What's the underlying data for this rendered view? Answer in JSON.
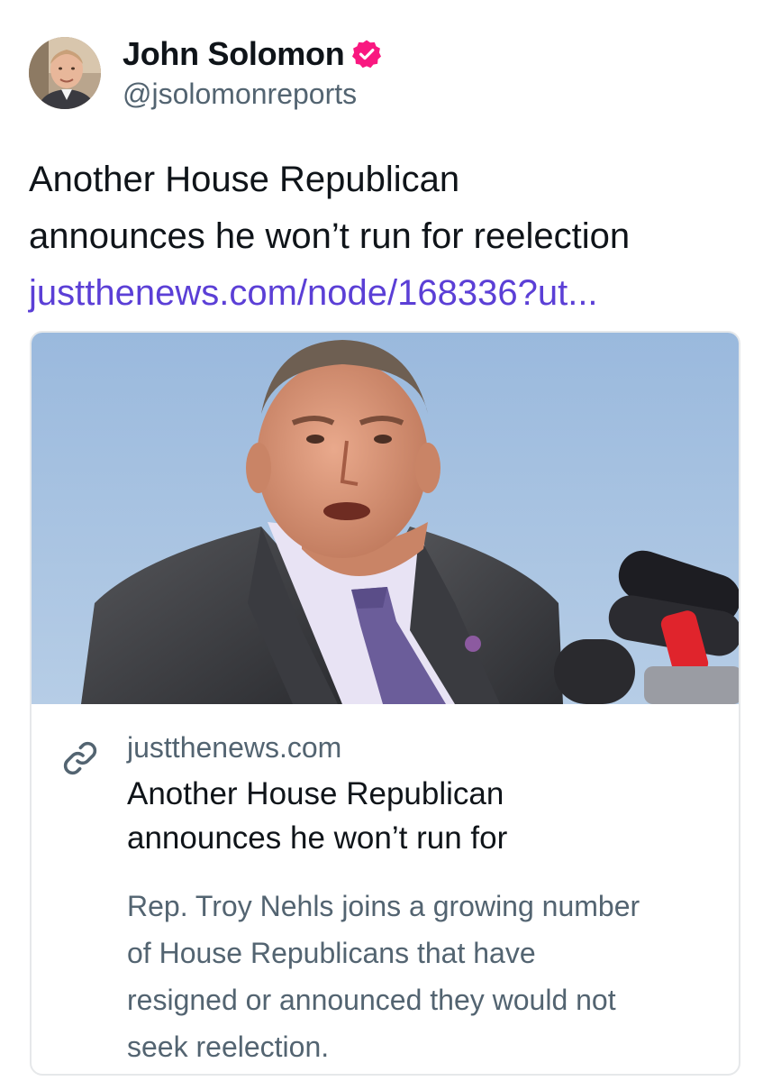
{
  "author": {
    "display_name": "John Solomon",
    "handle": "@jsolomonreports",
    "verified_icon": "verified-badge-icon",
    "verified_color": "#f91880"
  },
  "post": {
    "text_lines": [
      "Another House Republican",
      "announces he won’t run for reelection"
    ],
    "link_text": "justthenews.com/node/168336?ut...",
    "link_color": "#5b3fd6"
  },
  "link_card": {
    "icon": "link-icon",
    "domain": "justthenews.com",
    "title_lines": [
      "Another House Republican",
      "announces he won’t run for"
    ],
    "description_lines": [
      "Rep. Troy Nehls joins a growing number",
      "of House Republicans that have",
      "resigned or announced they would not",
      "seek reelection."
    ]
  }
}
